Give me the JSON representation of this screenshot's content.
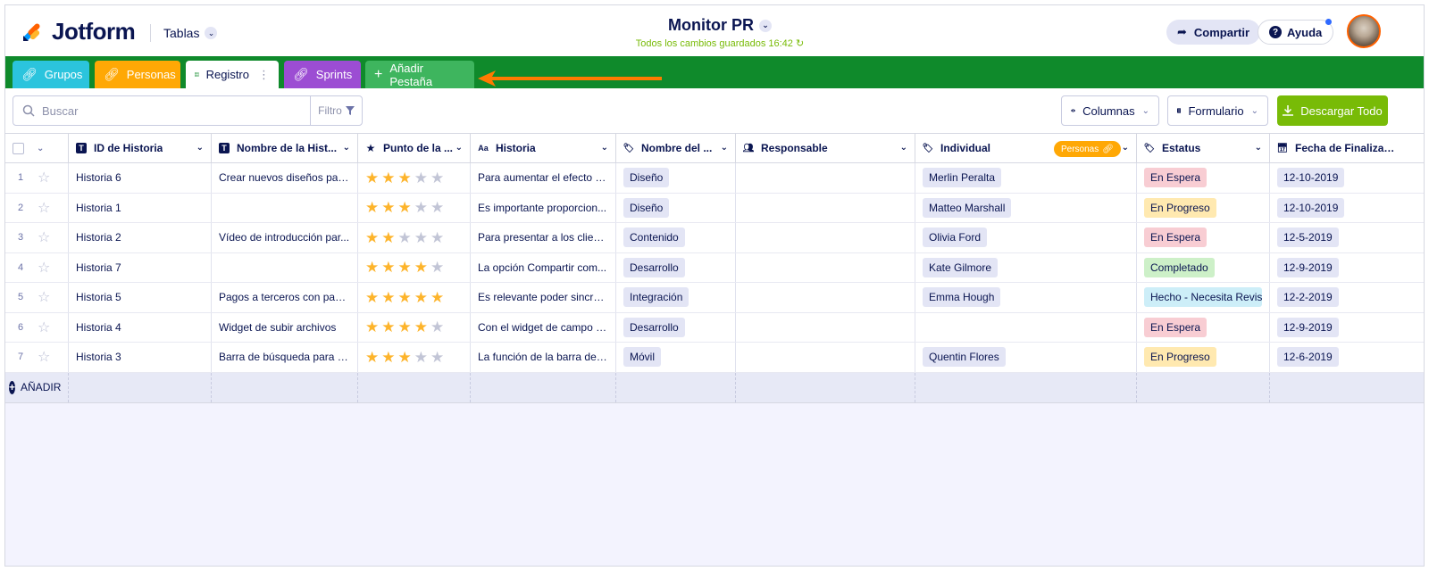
{
  "brand": {
    "name": "Jotform"
  },
  "nav": {
    "tables_label": "Tablas"
  },
  "header": {
    "title": "Monitor PR",
    "saved_status": "Todos los cambios guardados 16:42"
  },
  "actions": {
    "share_label": "Compartir",
    "help_label": "Ayuda"
  },
  "tabs": [
    {
      "label": "Grupos",
      "icon": "link-icon",
      "color": "#2bc4dd"
    },
    {
      "label": "Personas",
      "icon": "link-icon",
      "color": "#ffa805"
    },
    {
      "label": "Registro",
      "icon": "grid-icon",
      "active": true
    },
    {
      "label": "Sprints",
      "icon": "link-icon",
      "color": "#9c4dd3"
    },
    {
      "label": "Añadir Pestaña",
      "icon": "plus-icon",
      "color": "#3eb55e"
    }
  ],
  "toolbar": {
    "search_placeholder": "Buscar",
    "filter_label": "Filtro",
    "columns_label": "Columnas",
    "form_label": "Formulario",
    "download_label": "Descargar Todo"
  },
  "columns": [
    {
      "label": "ID de Historia",
      "icon": "text-icon"
    },
    {
      "label": "Nombre de la Hist...",
      "icon": "text-icon"
    },
    {
      "label": "Punto de la ...",
      "icon": "star-icon"
    },
    {
      "label": "Historia",
      "icon": "aa-icon"
    },
    {
      "label": "Nombre del ...",
      "icon": "tag-icon"
    },
    {
      "label": "Responsable",
      "icon": "people-icon"
    },
    {
      "label": "Individual",
      "icon": "tag-icon",
      "badge": "Personas"
    },
    {
      "label": "Estatus",
      "icon": "tag-icon"
    },
    {
      "label": "Fecha de Finalización",
      "icon": "calendar-icon"
    }
  ],
  "rows": [
    {
      "num": "1",
      "id": "Historia 6",
      "name": "Crear nuevos diseños para...",
      "rating": 3,
      "story": "Para aumentar el efecto d...",
      "category": "Diseño",
      "owner": "",
      "person": "Merlin Peralta",
      "status": "En Espera",
      "date": "12-10-2019"
    },
    {
      "num": "2",
      "id": "Historia 1",
      "name": "",
      "rating": 3,
      "story": "Es importante proporcion...",
      "category": "Diseño",
      "owner": "",
      "person": "Matteo Marshall",
      "status": "En Progreso",
      "date": "12-10-2019"
    },
    {
      "num": "3",
      "id": "Historia 2",
      "name": "Vídeo de introducción par...",
      "rating": 2,
      "story": "Para presentar a los client...",
      "category": "Contenido",
      "owner": "",
      "person": "Olivia Ford",
      "status": "En Espera",
      "date": "12-5-2019"
    },
    {
      "num": "4",
      "id": "Historia 7",
      "name": "",
      "rating": 4,
      "story": "La opción Compartir com...",
      "category": "Desarrollo",
      "owner": "",
      "person": "Kate Gilmore",
      "status": "Completado",
      "date": "12-9-2019"
    },
    {
      "num": "5",
      "id": "Historia 5",
      "name": "Pagos a terceros con pasa...",
      "rating": 5,
      "story": "Es relevante poder sincron...",
      "category": "Integración",
      "owner": "",
      "person": "Emma Hough",
      "status": "Hecho - Necesita Revisión",
      "date": "12-2-2019"
    },
    {
      "num": "6",
      "id": "Historia 4",
      "name": "Widget de subir archivos",
      "rating": 4,
      "story": "Con el widget de campo d...",
      "category": "Desarrollo",
      "owner": "",
      "person": "",
      "status": "En Espera",
      "date": "12-9-2019"
    },
    {
      "num": "7",
      "id": "Historia 3",
      "name": "Barra de búsqueda para a...",
      "rating": 3,
      "story": "La función de la barra de ...",
      "category": "Móvil",
      "owner": "",
      "person": "Quentin Flores",
      "status": "En Progreso",
      "date": "12-6-2019"
    }
  ],
  "add_row_label": "AÑADIR",
  "status_colors": {
    "En Espera": "#f8cdd3",
    "En Progreso": "#ffe9b0",
    "Completado": "#cdf0c8",
    "Hecho - Necesita Revisión": "#cdeef8"
  },
  "colors": {
    "accent_green": "#0f8a2b",
    "download_green": "#78bb07",
    "star_filled": "#fdb42b",
    "star_empty": "#c2c5d6",
    "arrow": "#ff7a00"
  }
}
